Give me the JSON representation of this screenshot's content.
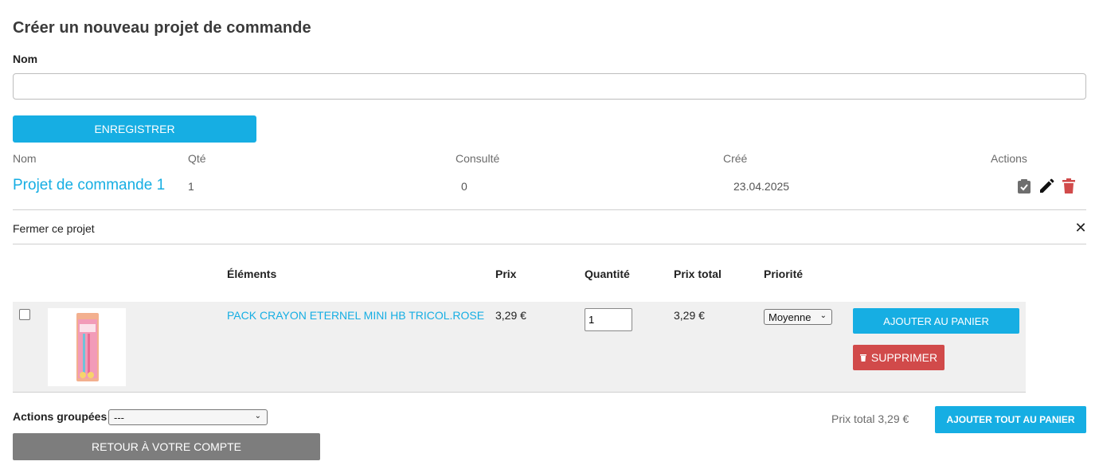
{
  "page": {
    "title": "Créer un nouveau projet de commande"
  },
  "form": {
    "name_label": "Nom",
    "name_value": "",
    "save_label": "Enregistrer"
  },
  "projects_table": {
    "headers": {
      "name": "Nom",
      "qty": "Qté",
      "viewed": "Consulté",
      "created": "Créé",
      "actions": "Actions"
    },
    "rows": [
      {
        "name": "Projet de commande 1",
        "qty": "1",
        "viewed": "0",
        "created": "23.04.2025"
      }
    ],
    "action_icons": [
      "clipboard-check-icon",
      "pencil-icon",
      "trash-icon"
    ]
  },
  "close_project": {
    "label": "Fermer ce projet",
    "icon": "close-icon"
  },
  "items_table": {
    "headers": {
      "items": "Éléments",
      "price": "Prix",
      "quantity": "Quantité",
      "total": "Prix total",
      "priority": "Priorité"
    },
    "rows": [
      {
        "product": "PACK CRAYON ETERNEL MINI HB TRICOL.ROSE",
        "price": "3,29 €",
        "quantity": "1",
        "total": "3,29 €",
        "priority": "Moyenne",
        "add_to_cart": "Ajouter au panier",
        "delete": "Supprimer"
      }
    ]
  },
  "footer": {
    "group_actions_label": "Actions groupées :",
    "group_actions_value": "---",
    "total_label": "Prix total 3,29 €",
    "add_all_label": "Ajouter tout au panier",
    "back_label": "Retour à votre compte"
  },
  "colors": {
    "accent": "#16aee3",
    "danger": "#d14a4a",
    "neutral_button": "#7d7d7d"
  }
}
